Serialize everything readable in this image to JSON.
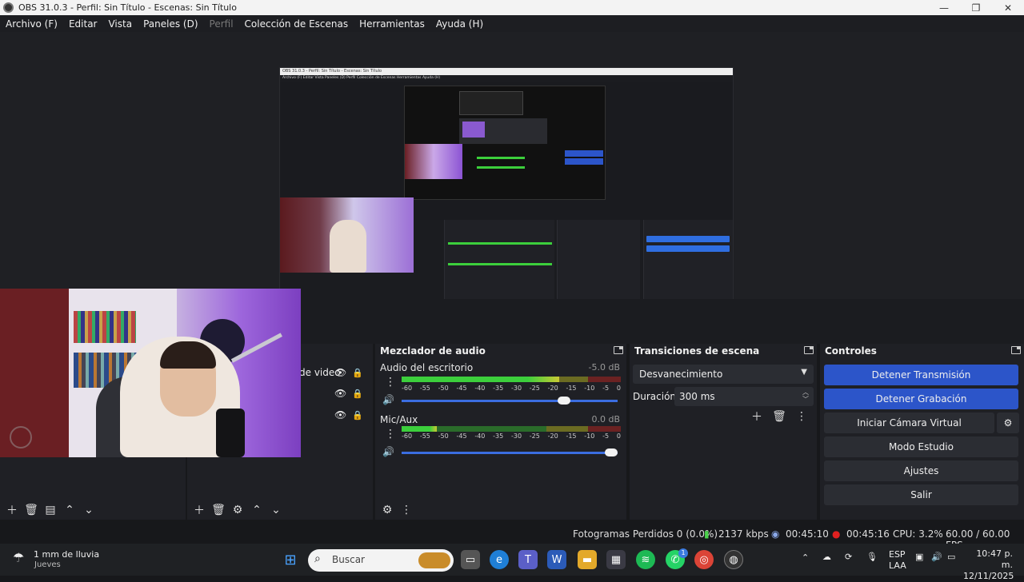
{
  "window": {
    "title": "OBS 31.0.3 - Perfil: Sin Título - Escenas: Sin Título",
    "min": "—",
    "max": "❐",
    "close": "✕"
  },
  "menu": {
    "items": [
      {
        "label": "Archivo (F)",
        "enabled": true
      },
      {
        "label": "Editar",
        "enabled": true
      },
      {
        "label": "Vista",
        "enabled": true
      },
      {
        "label": "Paneles (D)",
        "enabled": true
      },
      {
        "label": "Perfil",
        "enabled": false
      },
      {
        "label": "Colección de Escenas",
        "enabled": true
      },
      {
        "label": "Herramientas",
        "enabled": true
      },
      {
        "label": "Ayuda (H)",
        "enabled": true
      }
    ]
  },
  "sources": {
    "rows": [
      {
        "label": "de video"
      },
      {
        "label": ""
      },
      {
        "label": ""
      }
    ]
  },
  "mixer": {
    "title": "Mezclador de audio",
    "channels": [
      {
        "name": "Audio del escritorio",
        "db": "-5.0 dB",
        "level": 0.72,
        "volume": 0.78
      },
      {
        "name": "Mic/Aux",
        "db": "0.0 dB",
        "level": 0.16,
        "volume": 1.0
      }
    ],
    "ticks": [
      "-60",
      "-55",
      "-50",
      "-45",
      "-40",
      "-35",
      "-30",
      "-25",
      "-20",
      "-15",
      "-10",
      "-5",
      "0"
    ]
  },
  "transitions": {
    "title": "Transiciones de escena",
    "selected": "Desvanecimiento",
    "duration_label": "Duración",
    "duration_value": "300 ms"
  },
  "controls": {
    "title": "Controles",
    "buttons": [
      {
        "label": "Detener Transmisión",
        "active": true
      },
      {
        "label": "Detener Grabación",
        "active": true
      },
      {
        "label": "Iniciar Cámara Virtual",
        "active": false
      },
      {
        "label": "Modo Estudio",
        "active": false
      },
      {
        "label": "Ajustes",
        "active": false
      },
      {
        "label": "Salir",
        "active": false
      }
    ]
  },
  "status": {
    "dropped": "Fotogramas Perdidos 0 (0.0%)",
    "bitrate": "2137 kbps",
    "stream_time": "00:45:10",
    "rec_time": "00:45:16",
    "cpu": "CPU: 3.2%",
    "fps": "60.00 / 60.00 FPS"
  },
  "taskbar": {
    "weather_main": "1 mm de lluvia",
    "weather_sub": "Jueves",
    "search_placeholder": "Buscar",
    "lang_top": "ESP",
    "lang_bottom": "LAA",
    "time": "10:47 p. m.",
    "date": "12/11/2025",
    "badge_count": "1"
  },
  "nested_preview": {
    "title": "OBS 31.0.3 - Perfil: Sin Título - Escenas: Sin Título",
    "menu": "Archivo (F)   Editar   Vista   Paneles (D)   Perfil   Colección de Escenas   Herramientas   Ayuda (H)"
  },
  "colors": {
    "accent": "#2c55c9",
    "panel": "#1f2025",
    "bg": "#17181b"
  }
}
